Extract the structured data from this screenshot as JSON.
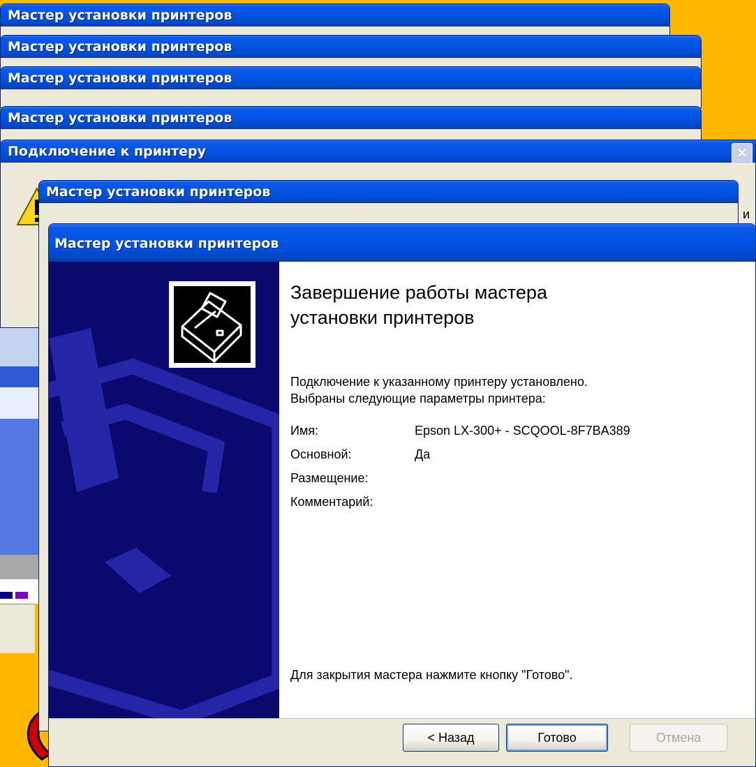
{
  "windows": {
    "back_title": "Мастер установки принтеров",
    "connect_title": "Подключение к принтеру",
    "connect_close": "✕",
    "connect_text_fragment": "и",
    "middle_title": "Мастер установки принтеров",
    "main_title": "Мастер установки принтеров"
  },
  "wizard": {
    "heading_line1": "Завершение работы мастера",
    "heading_line2": "установки принтеров",
    "intro_line1": "Подключение к указанному принтеру установлено.",
    "intro_line2": "Выбраны следующие параметры принтера:",
    "fields": [
      {
        "label": "Имя:",
        "value": "Epson LX-300+ - SCQOOL-8F7BA389"
      },
      {
        "label": "Основной:",
        "value": "Да"
      },
      {
        "label": "Размещение:",
        "value": ""
      },
      {
        "label": "Комментарий:",
        "value": ""
      }
    ],
    "footer_text": "Для закрытия мастера нажмите кнопку \"Готово\".",
    "buttons": {
      "back": "< Назад",
      "finish": "Готово",
      "cancel": "Отмена"
    }
  },
  "colors": {
    "background": "#FFB800",
    "titlebar": "#0054E3",
    "wizard_side": "#0A0A6E",
    "dialog_face": "#ECE9D8"
  },
  "icons": [
    "warning-icon",
    "printer-icon",
    "close-icon"
  ]
}
